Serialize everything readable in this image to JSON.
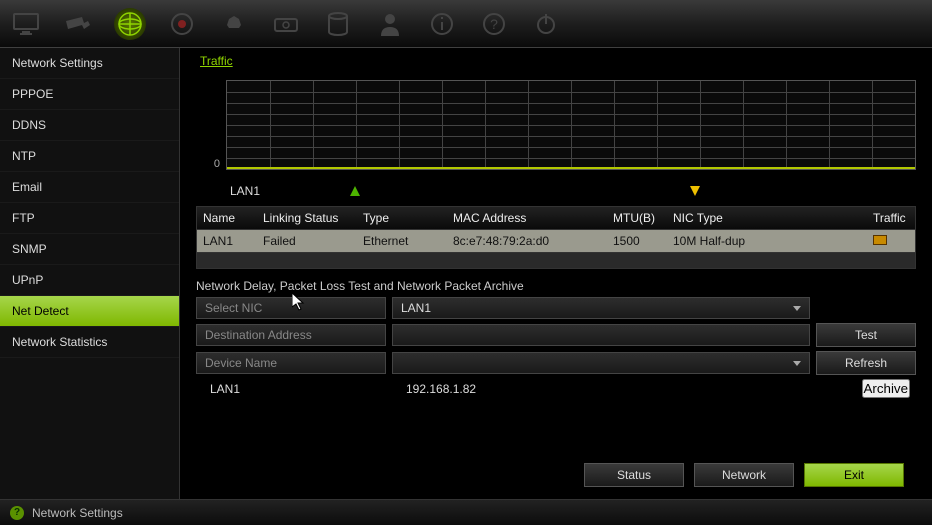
{
  "topIcons": [
    "monitor",
    "camera",
    "network",
    "record",
    "alarm",
    "hdd",
    "storage",
    "user",
    "info",
    "help",
    "power"
  ],
  "sidebar": {
    "items": [
      {
        "label": "Network Settings"
      },
      {
        "label": "PPPOE"
      },
      {
        "label": "DDNS"
      },
      {
        "label": "NTP"
      },
      {
        "label": "Email"
      },
      {
        "label": "FTP"
      },
      {
        "label": "SNMP"
      },
      {
        "label": "UPnP"
      },
      {
        "label": "Net Detect"
      },
      {
        "label": "Network Statistics"
      }
    ],
    "selectedIndex": 8
  },
  "traffic": {
    "title": "Traffic",
    "yZero": "0",
    "interfaceLabel": "LAN1"
  },
  "nicTable": {
    "headers": {
      "name": "Name",
      "linking": "Linking Status",
      "type": "Type",
      "mac": "MAC Address",
      "mtu": "MTU(B)",
      "nic": "NIC Type",
      "traffic": "Traffic"
    },
    "rows": [
      {
        "name": "LAN1",
        "linking": "Failed",
        "type": "Ethernet",
        "mac": "8c:e7:48:79:2a:d0",
        "mtu": "1500",
        "nic": "10M Half-dup"
      }
    ]
  },
  "section": {
    "title": "Network Delay, Packet Loss Test and Network Packet Archive"
  },
  "form": {
    "selectNicLabel": "Select NIC",
    "selectNicValue": "LAN1",
    "destLabel": "Destination Address",
    "destValue": "",
    "deviceLabel": "Device Name",
    "deviceValue": "",
    "testBtn": "Test",
    "refreshBtn": "Refresh",
    "archiveBtn": "Archive"
  },
  "info": {
    "label": "LAN1",
    "value": "192.168.1.82"
  },
  "bottom": {
    "status": "Status",
    "network": "Network",
    "exit": "Exit"
  },
  "statusbar": {
    "text": "Network Settings"
  },
  "chart_data": {
    "type": "line",
    "title": "Traffic",
    "xlabel": "",
    "ylabel": "",
    "ylim": [
      0,
      10
    ],
    "x": [],
    "series": [
      {
        "name": "Upload",
        "values": []
      },
      {
        "name": "Download",
        "values": []
      }
    ],
    "note": "No traffic data; link status Failed"
  }
}
